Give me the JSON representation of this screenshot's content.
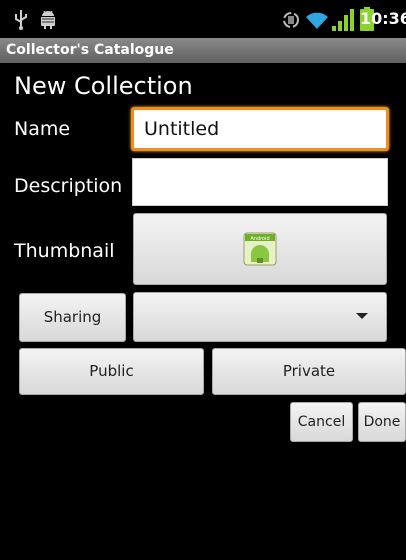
{
  "status_bar": {
    "time": "10:36",
    "icons": [
      "usb-icon",
      "android-notification-icon",
      "rotation-lock-icon",
      "wifi-icon",
      "signal-icon",
      "battery-icon"
    ],
    "colors": {
      "wifi": "#2fa6e0",
      "signal": "#8ad22c",
      "battery": "#8ad22c"
    }
  },
  "app": {
    "title": "Collector's Catalogue",
    "heading": "New Collection"
  },
  "form": {
    "name_label": "Name",
    "name_value": "Untitled",
    "description_label": "Description",
    "description_value": "",
    "thumbnail_label": "Thumbnail",
    "thumbnail_icon": "android-app-icon",
    "thumbnail_icon_text": "Android",
    "sharing_label": "Sharing",
    "sharing_selected": "",
    "public_label": "Public",
    "private_label": "Private",
    "cancel_label": "Cancel",
    "done_label": "Done"
  },
  "colors": {
    "background": "#000000",
    "title_bar": "#747474",
    "focus_border": "#f28c1c",
    "button_face": "#e6e6e6"
  }
}
